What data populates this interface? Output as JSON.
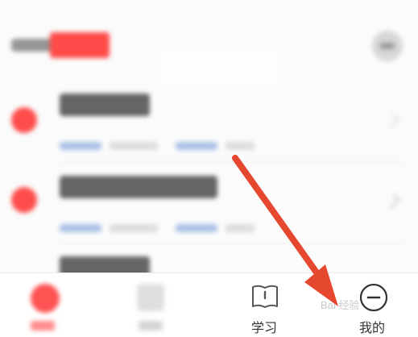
{
  "tabbar": {
    "tabs": [
      {
        "label": ""
      },
      {
        "label": ""
      },
      {
        "label": "学习",
        "icon": "book-icon"
      },
      {
        "label": "我的",
        "icon": "profile-icon"
      }
    ]
  },
  "watermark": {
    "text": "Bai 经验"
  },
  "colors": {
    "accent": "#ff4d4d",
    "arrow": "#e5482f",
    "link": "#a9c2e6"
  }
}
